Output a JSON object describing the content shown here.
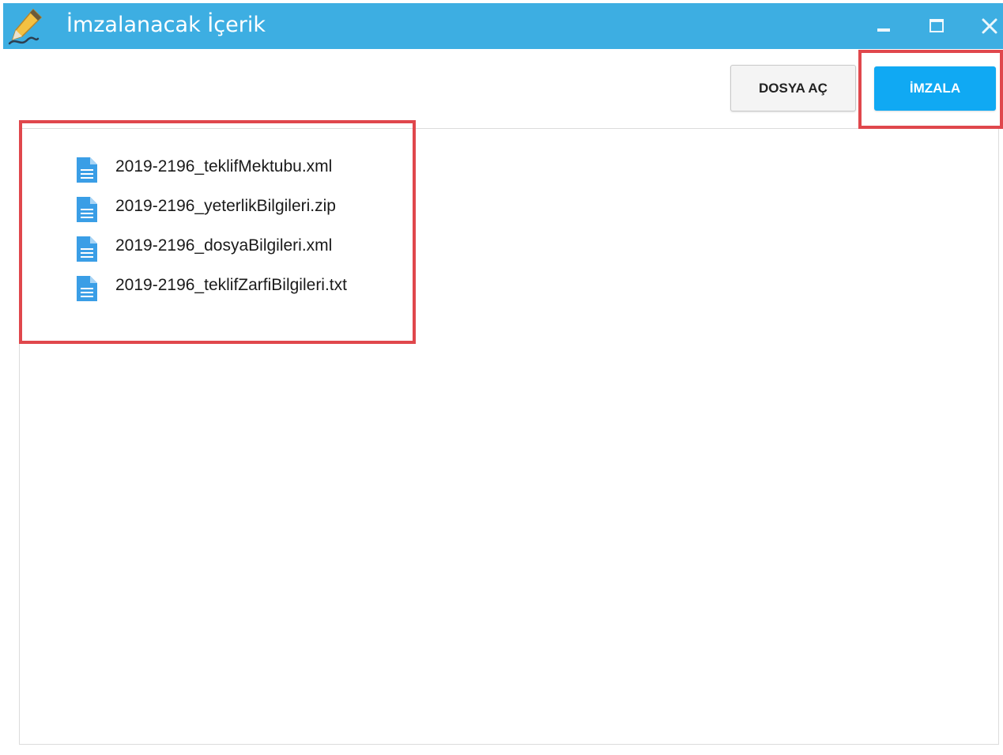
{
  "window": {
    "title": "İmzalanacak İçerik",
    "titlebar_color": "#3daee2",
    "icon": "pen-icon"
  },
  "window_controls": {
    "minimize_icon": "minimize-icon",
    "maximize_icon": "maximize-icon",
    "close_icon": "close-icon"
  },
  "toolbar": {
    "open_label": "DOSYA AÇ",
    "sign_label": "İMZALA",
    "sign_color": "#10a9f3"
  },
  "files": [
    {
      "name": "2019-2196_teklifMektubu.xml",
      "icon": "document-icon"
    },
    {
      "name": "2019-2196_yeterlikBilgileri.zip",
      "icon": "document-icon"
    },
    {
      "name": "2019-2196_dosyaBilgileri.xml",
      "icon": "document-icon"
    },
    {
      "name": "2019-2196_teklifZarfiBilgileri.txt",
      "icon": "document-icon"
    }
  ],
  "annotation_color": "#e0474c"
}
